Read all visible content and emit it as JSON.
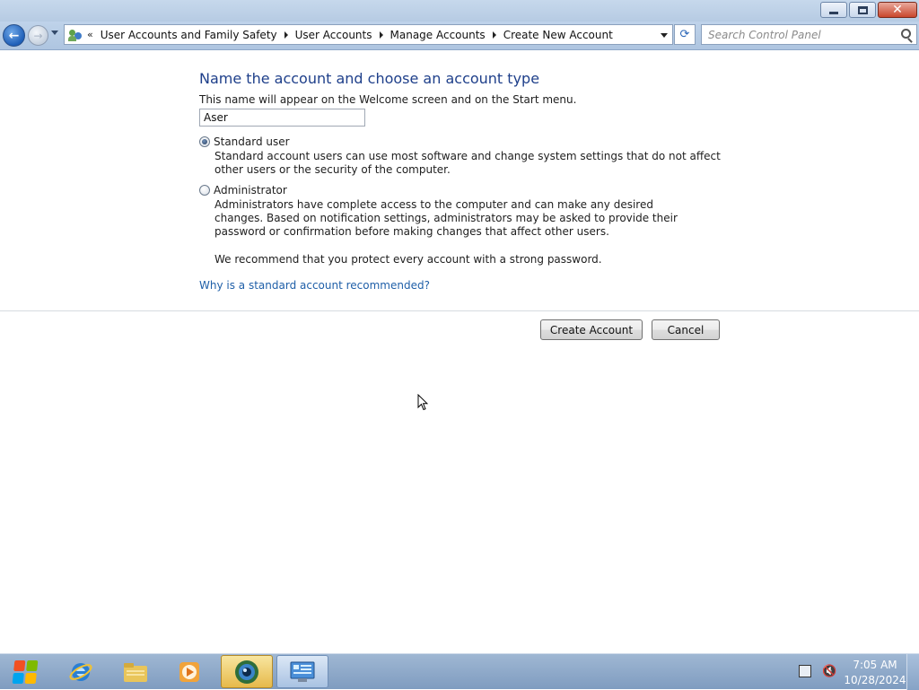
{
  "window": {
    "controls": {
      "minimize": "minimize",
      "restore": "restore",
      "close": "✕"
    }
  },
  "navbar": {
    "back_glyph": "←",
    "forward_glyph": "→",
    "overflow_glyph": "«",
    "breadcrumbs": [
      {
        "label": "User Accounts and Family Safety"
      },
      {
        "label": "User Accounts"
      },
      {
        "label": "Manage Accounts"
      },
      {
        "label": "Create New Account"
      }
    ],
    "refresh_glyph": "⟳",
    "search_placeholder": "Search Control Panel"
  },
  "page": {
    "heading": "Name the account and choose an account type",
    "name_description": "This name will appear on the Welcome screen and on the Start menu.",
    "account_name_value": "Aser",
    "options": [
      {
        "label": "Standard user",
        "checked": true,
        "description": "Standard account users can use most software and change system settings that do not affect other users or the security of the computer."
      },
      {
        "label": "Administrator",
        "checked": false,
        "description": "Administrators have complete access to the computer and can make any desired changes. Based on notification settings, administrators may be asked to provide their password or confirmation before making changes that affect other users."
      }
    ],
    "recommendation": "We recommend that you protect every account with a strong password.",
    "help_link": "Why is a standard account recommended?",
    "create_button": "Create Account",
    "cancel_button": "Cancel"
  },
  "taskbar": {
    "items": [
      {
        "icon": "internet-explorer-icon"
      },
      {
        "icon": "file-explorer-icon"
      },
      {
        "icon": "media-player-icon"
      },
      {
        "icon": "webcam-app-icon",
        "state": "active"
      },
      {
        "icon": "control-panel-icon",
        "state": "open"
      }
    ],
    "clock_time": "7:05 AM",
    "clock_date": "10/28/2024",
    "volume_glyph": "🔇"
  },
  "colors": {
    "heading": "#1e3f8a",
    "link": "#1f5fa8",
    "taskbar": "#8fa9ca"
  }
}
